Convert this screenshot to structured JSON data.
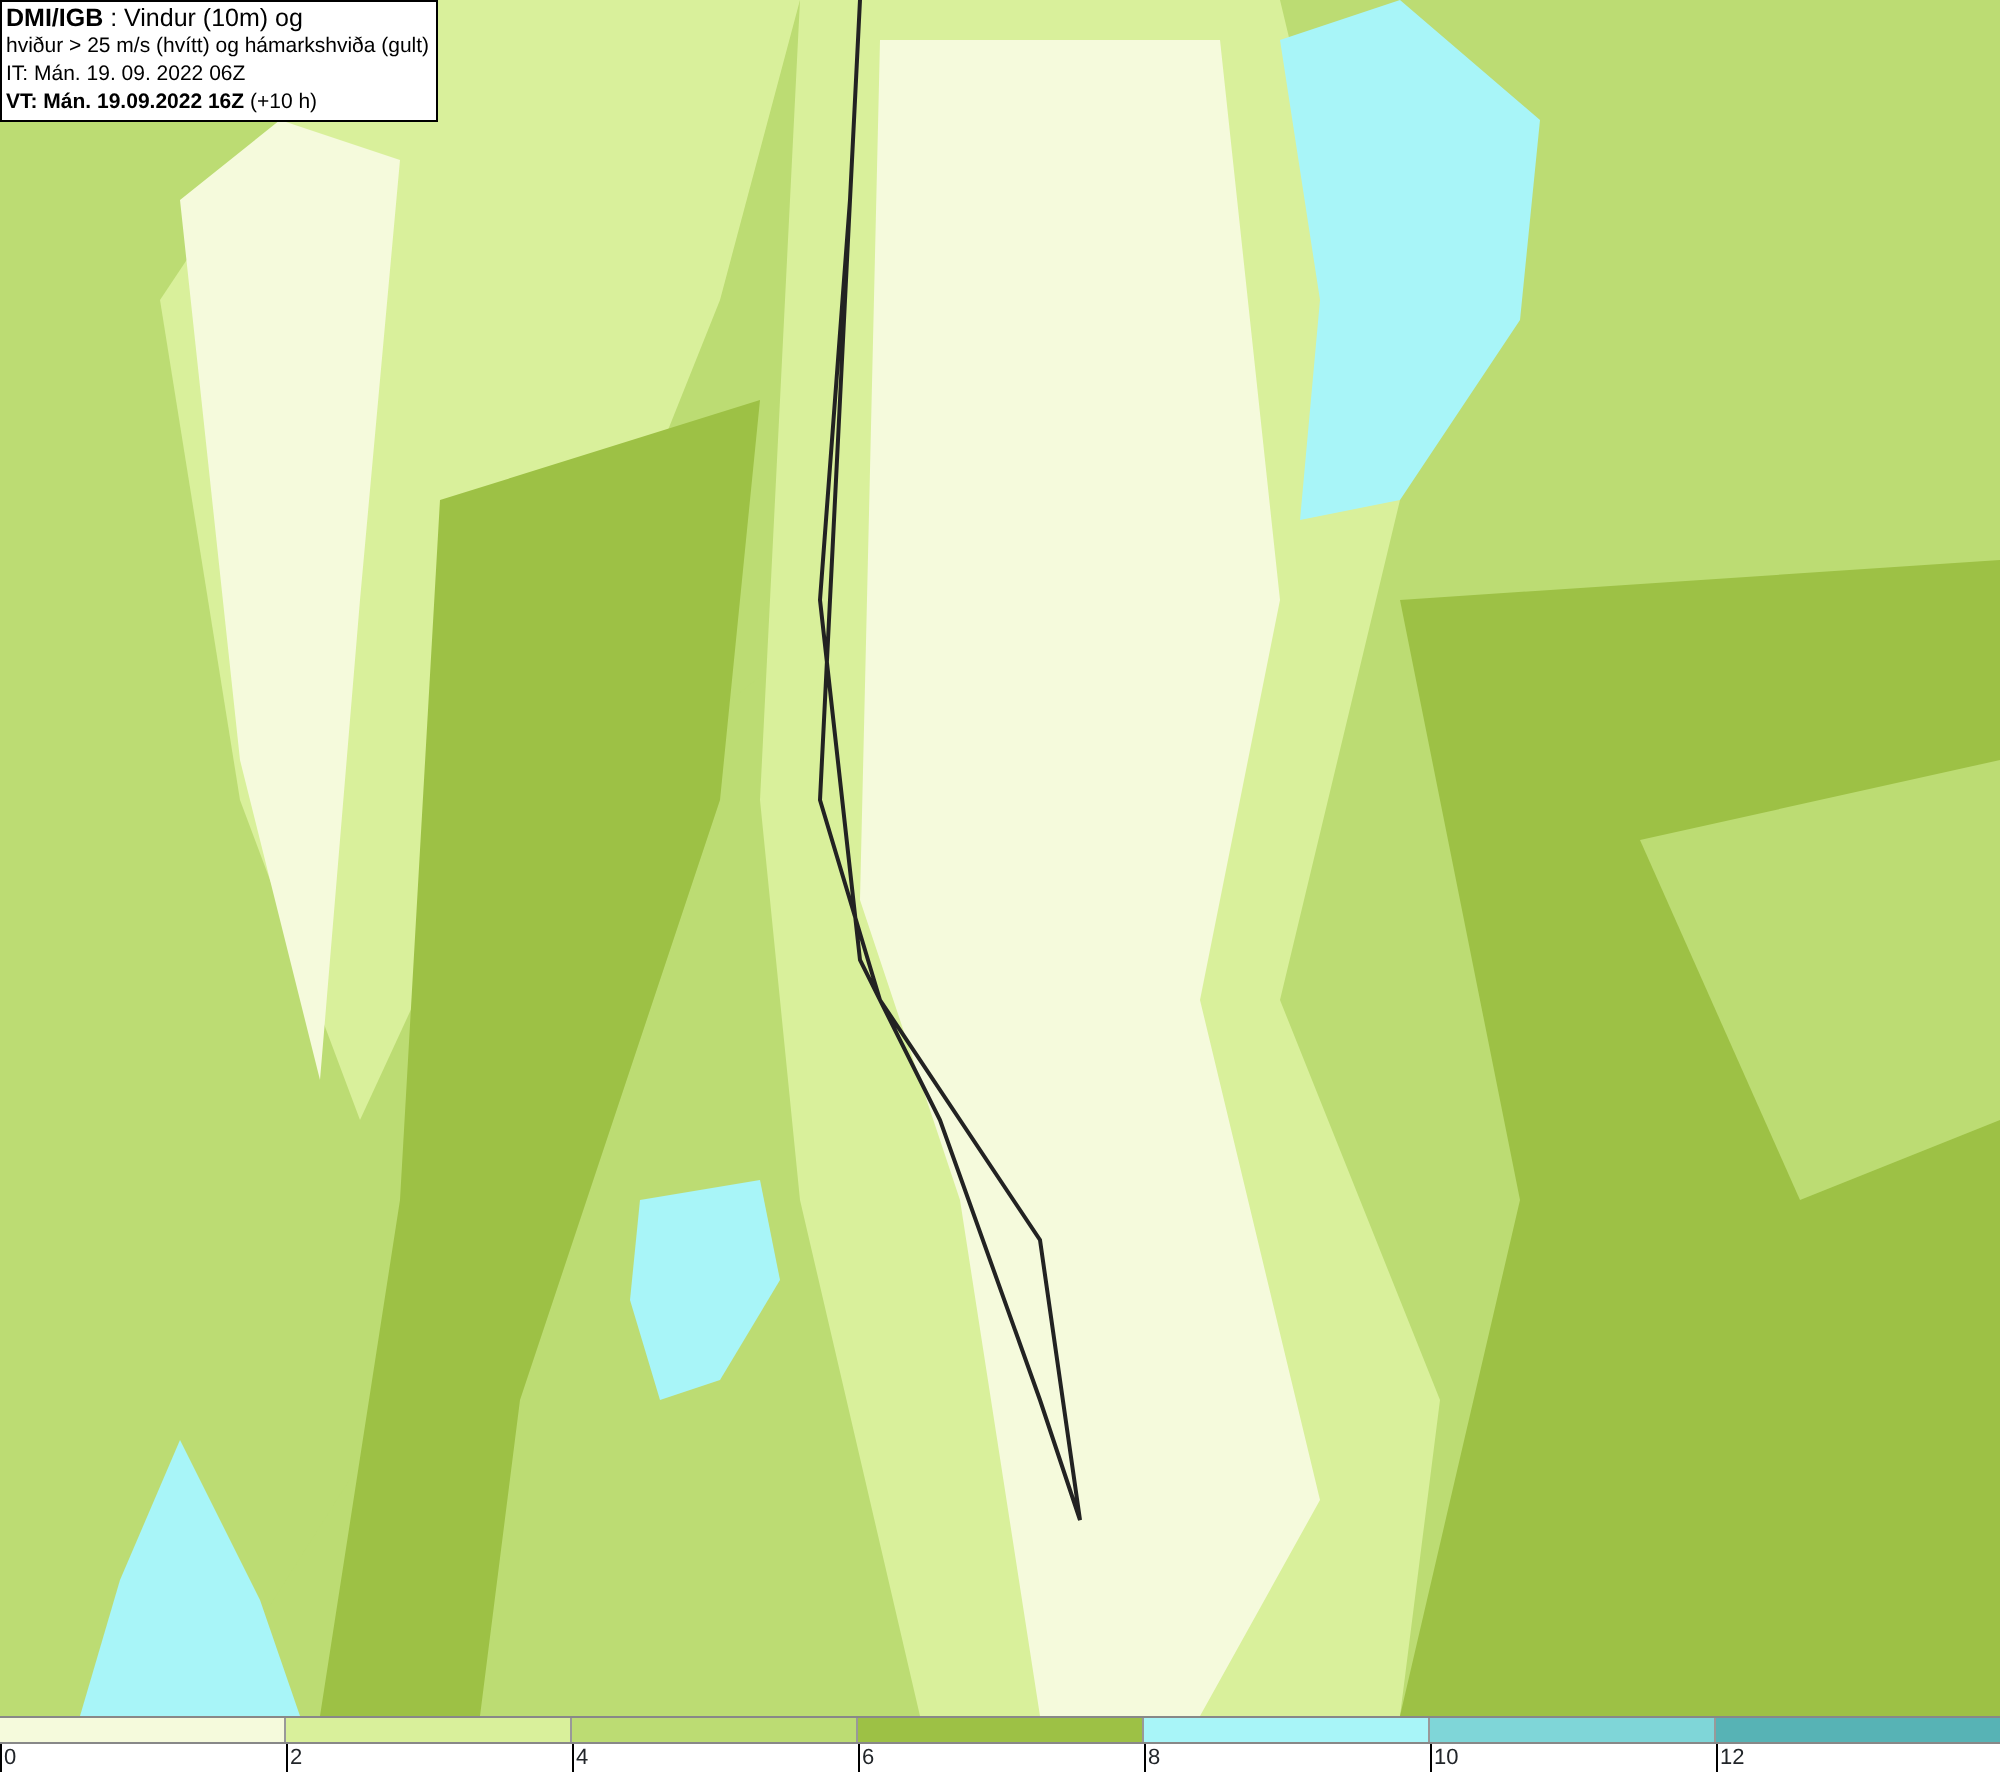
{
  "title_box": {
    "lines": [
      "**DMI/IGB** : Vindur (10m) og",
      "hviður > 25 m/s (hvítt) og hámarkshviða (gult)",
      "IT: Mán. 19. 09. 2022 06Z",
      "**VT: Mán. 19.09.2022 16Z** (+10 h)"
    ]
  },
  "legend": {
    "bins": [
      {
        "color": "#f5fadc"
      },
      {
        "color": "#d9f09b"
      },
      {
        "color": "#bcdc73"
      },
      {
        "color": "#9dc145"
      },
      {
        "color": "#a8f5f8"
      },
      {
        "color": "#7fd6d8"
      },
      {
        "color": "#57b3b5"
      }
    ],
    "ticks": [
      "0",
      "2",
      "4",
      "6",
      "8",
      "10",
      "12"
    ]
  }
}
